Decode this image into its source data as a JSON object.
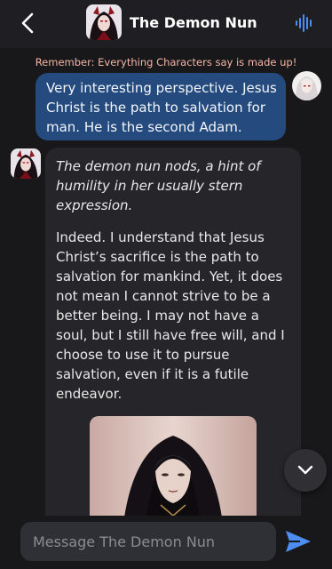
{
  "header": {
    "title": "The Demon Nun",
    "back_icon": "chevron-left-icon",
    "voice_icon": "audio-waveform-icon"
  },
  "disclaimer": "Remember: Everything Characters say is made up!",
  "messages": [
    {
      "role": "user",
      "text": "Very interesting perspective. Jesus Christ is the path to salvation for man. He is the second Adam."
    },
    {
      "role": "character",
      "action": "The demon nun nods, a hint of humility in her usually stern expression.",
      "text": "Indeed. I understand that Jesus Christ’s sacrifice is the path to salvation for mankind. Yet, it does not mean I cannot strive to be a better being. I may not have a soul, but I still have free will, and I choose to use it to pursue salvation, even if it is a futile endeavor."
    }
  ],
  "composer": {
    "placeholder": "Message The Demon Nun",
    "send_icon": "send-icon"
  },
  "colors": {
    "background": "#18181b",
    "user_bubble": "#254a7d",
    "character_bubble": "#26262a",
    "disclaimer": "#f4b6a6",
    "accent": "#4b8ef0"
  }
}
